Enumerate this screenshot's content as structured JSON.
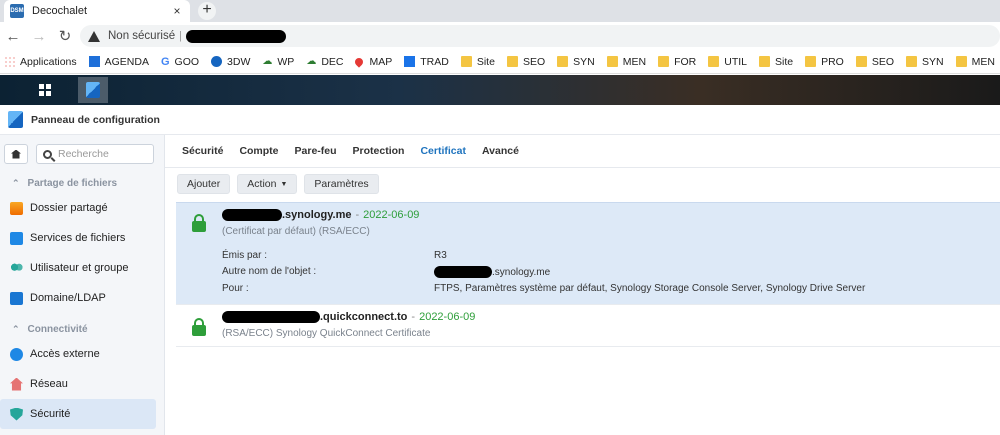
{
  "browser": {
    "tab_title": "Decochalet",
    "favicon_text": "DSM",
    "close_glyph": "×",
    "new_tab_glyph": "+",
    "security_text": "Non sécurisé",
    "omnibox_sep": "|"
  },
  "bookmarks": [
    {
      "label": "Applications",
      "icon": "apps-icon"
    },
    {
      "label": "AGENDA",
      "icon": "calendar-icon"
    },
    {
      "label": "GOO",
      "icon": "google-icon"
    },
    {
      "label": "3DW",
      "icon": "circle-icon"
    },
    {
      "label": "WP",
      "icon": "leaf-icon"
    },
    {
      "label": "DEC",
      "icon": "leaf-icon"
    },
    {
      "label": "MAP",
      "icon": "map-pin-icon"
    },
    {
      "label": "TRAD",
      "icon": "translate-icon"
    },
    {
      "label": "Site",
      "icon": "folder-icon"
    },
    {
      "label": "SEO",
      "icon": "folder-icon"
    },
    {
      "label": "SYN",
      "icon": "folder-icon"
    },
    {
      "label": "MEN",
      "icon": "folder-icon"
    },
    {
      "label": "FOR",
      "icon": "folder-icon"
    },
    {
      "label": "UTIL",
      "icon": "folder-icon"
    },
    {
      "label": "Site",
      "icon": "folder-icon"
    },
    {
      "label": "PRO",
      "icon": "folder-icon"
    },
    {
      "label": "SEO",
      "icon": "folder-icon"
    },
    {
      "label": "SYN",
      "icon": "folder-icon"
    },
    {
      "label": "MEN",
      "icon": "folder-icon"
    }
  ],
  "window": {
    "title": "Panneau de configuration"
  },
  "sidebar": {
    "search_placeholder": "Recherche",
    "sections": [
      {
        "label": "Partage de fichiers",
        "items": [
          {
            "label": "Dossier partagé"
          },
          {
            "label": "Services de fichiers"
          },
          {
            "label": "Utilisateur et groupe"
          },
          {
            "label": "Domaine/LDAP"
          }
        ]
      },
      {
        "label": "Connectivité",
        "items": [
          {
            "label": "Accès externe"
          },
          {
            "label": "Réseau"
          },
          {
            "label": "Sécurité"
          }
        ]
      }
    ]
  },
  "tabs": [
    "Sécurité",
    "Compte",
    "Pare-feu",
    "Protection",
    "Certificat",
    "Avancé"
  ],
  "active_tab": "Certificat",
  "actions": {
    "add": "Ajouter",
    "action": "Action",
    "settings": "Paramètres"
  },
  "certificates": [
    {
      "name_suffix": ".synology.me",
      "dash": "-",
      "date": "2022-06-09",
      "subtitle": "(Certificat par défaut) (RSA/ECC)",
      "details": {
        "issuer_label": "Émis par :",
        "issuer_value": "R3",
        "altname_label": "Autre nom de l'objet :",
        "altname_value": ".synology.me",
        "purpose_label": "Pour :",
        "purpose_value": "FTPS, Paramètres système par défaut, Synology Storage Console Server, Synology Drive Server"
      }
    },
    {
      "name_suffix": ".quickconnect.to",
      "dash": "-",
      "date": "2022-06-09",
      "subtitle": "(RSA/ECC) Synology QuickConnect Certificate"
    }
  ]
}
